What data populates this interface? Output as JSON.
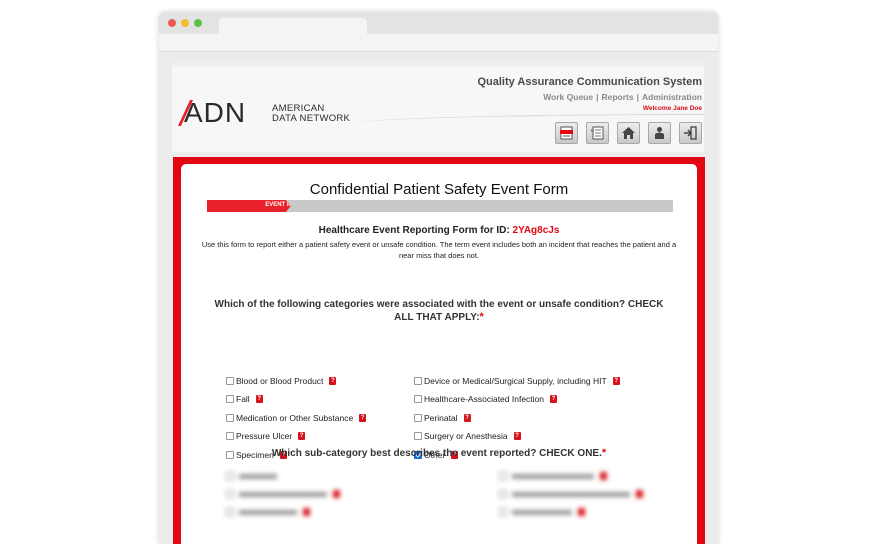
{
  "header": {
    "logo_mark": "ADN",
    "logo_line1": "AMERICAN",
    "logo_line2": "DATA NETWORK",
    "system_title": "Quality Assurance Communication System",
    "nav": [
      "Work Queue",
      "Reports",
      "Administration"
    ],
    "nav_sep": "|",
    "welcome": "Welcome Jane Doe",
    "icon_buttons": [
      "event-form-icon",
      "document-icon",
      "home-icon",
      "user-icon",
      "logout-icon"
    ]
  },
  "form": {
    "title": "Confidential Patient Safety Event Form",
    "progress_label": "EVENT INFORMATION",
    "progress_fraction": 0.18,
    "subtitle_prefix": "Healthcare Event Reporting Form for ID:",
    "form_id": "2YAg8cJs",
    "intro": "Use this form to report either a patient safety event or unsafe condition. The term event includes both an incident that reaches the patient and a near miss that does not.",
    "question1": "Which of the following categories were associated with the event or unsafe condition? CHECK ALL THAT APPLY:",
    "required_mark": "*",
    "help_mark": "?",
    "categories_left": [
      {
        "label": "Blood or Blood Product",
        "checked": false
      },
      {
        "label": "Fall",
        "checked": false
      },
      {
        "label": "Medication or Other Substance",
        "checked": false
      },
      {
        "label": "Pressure Ulcer",
        "checked": false
      },
      {
        "label": "Specimen",
        "checked": false
      }
    ],
    "categories_right": [
      {
        "label": "Device or Medical/Surgical Supply, including HIT",
        "checked": false
      },
      {
        "label": "Healthcare-Associated Infection",
        "checked": false
      },
      {
        "label": "Perinatal",
        "checked": false
      },
      {
        "label": "Surgery or Anesthesia",
        "checked": false
      },
      {
        "label": "Other",
        "checked": true
      }
    ],
    "question2": "Which sub-category best describes the event reported? CHECK ONE."
  },
  "colors": {
    "brand_red": "#e30613",
    "checkbox_blue": "#1a73e8"
  }
}
